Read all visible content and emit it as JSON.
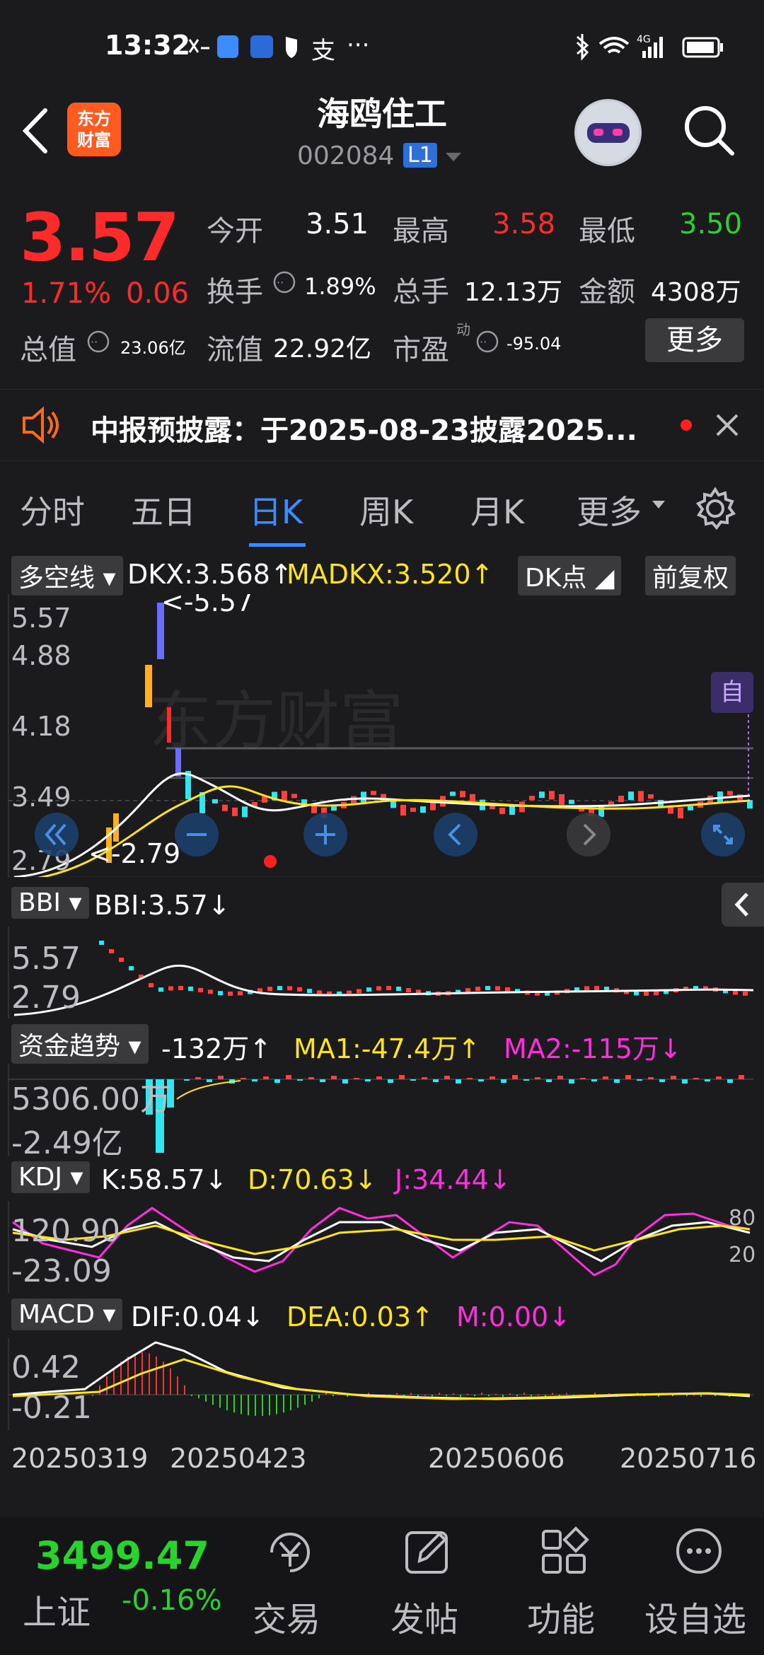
{
  "status_bar": {
    "time": "13:32",
    "network": "4G"
  },
  "header": {
    "title": "海鸥住工",
    "code": "002084",
    "level_badge": "L1",
    "logo_text_1": "东方",
    "logo_text_2": "财富"
  },
  "quote": {
    "price": "3.57",
    "change_pct": "1.71%",
    "change": "0.06",
    "open_label": "今开",
    "open": "3.51",
    "high_label": "最高",
    "high": "3.58",
    "low_label": "最低",
    "low": "3.50",
    "turnover_label": "换手",
    "turnover": "1.89%",
    "volume_label": "总手",
    "volume": "12.13万",
    "amount_label": "金额",
    "amount": "4308万",
    "mktcap_label": "总值",
    "mktcap": "23.06亿",
    "float_label": "流值",
    "float": "22.92亿",
    "pe_label": "市盈",
    "pe_sup": "动",
    "pe": "-95.04",
    "more_label": "更多"
  },
  "notice": {
    "text": "中报预披露：于2025-08-23披露2025..."
  },
  "tabs": [
    {
      "label": "分时"
    },
    {
      "label": "五日"
    },
    {
      "label": "日K"
    },
    {
      "label": "周K"
    },
    {
      "label": "月K"
    },
    {
      "label": "更多"
    }
  ],
  "main_indicator": {
    "name": "多空线",
    "dkx": "DKX:3.568↑",
    "madkx": "MADKX:3.520↑",
    "dk_point": "DK点",
    "adjust": "前复权",
    "y_labels": [
      "5.57",
      "4.88",
      "4.18",
      "3.49",
      "2.79"
    ],
    "max_marker": "<-5.57",
    "min_marker": "<-2.79",
    "watermark": "东方财富",
    "self_tag": "自"
  },
  "bbi": {
    "name": "BBI",
    "value": "BBI:3.57↓",
    "y_labels": [
      "5.57",
      "2.79"
    ]
  },
  "fund": {
    "name": "资金趋势",
    "value": "-132万↑",
    "ma1": "MA1:-47.4万↑",
    "ma2": "MA2:-115万↓",
    "y_labels": [
      "5306.00万",
      "-2.49亿"
    ]
  },
  "kdj": {
    "name": "KDJ",
    "k": "K:58.57↓",
    "d": "D:70.63↓",
    "j": "J:34.44↓",
    "y_labels": [
      "120.90",
      "-23.09"
    ],
    "right_labels": [
      "80",
      "20"
    ]
  },
  "macd": {
    "name": "MACD",
    "dif": "DIF:0.04↓",
    "dea": "DEA:0.03↑",
    "m": "M:0.00↓",
    "y_labels": [
      "0.42",
      "-0.21"
    ]
  },
  "dates": [
    "20250319",
    "20250423",
    "20250606",
    "20250716"
  ],
  "bottom": {
    "index_value": "3499.47",
    "index_name": "上证",
    "index_pct": "-0.16%",
    "nav": [
      {
        "label": "交易"
      },
      {
        "label": "发帖"
      },
      {
        "label": "功能"
      },
      {
        "label": "设自选"
      }
    ]
  },
  "colors": {
    "up": "#ff2a2a",
    "down": "#29d32e",
    "accent": "#3c8cff",
    "yellow": "#ffe419",
    "magenta": "#ff2ee0",
    "cyan": "#32e6f0"
  }
}
